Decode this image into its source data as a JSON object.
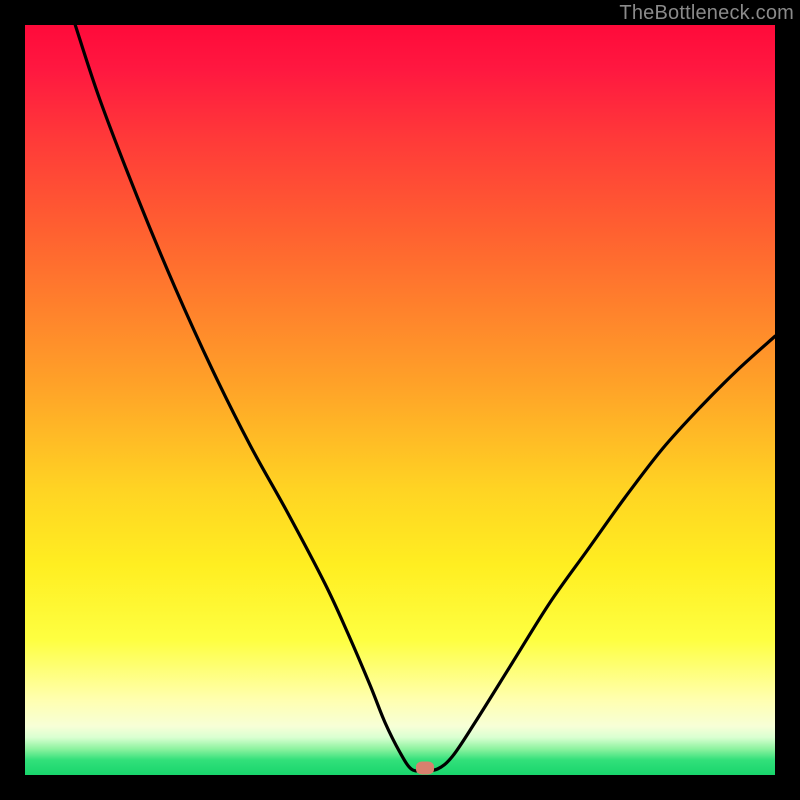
{
  "watermark": "TheBottleneck.com",
  "marker": {
    "x_pct": 53.3,
    "y_pct": 99.1
  },
  "chart_data": {
    "type": "line",
    "title": "",
    "xlabel": "",
    "ylabel": "",
    "xlim": [
      0,
      100
    ],
    "ylim": [
      0,
      100
    ],
    "series": [
      {
        "name": "bottleneck-curve",
        "x": [
          6.7,
          10,
          15,
          20,
          25,
          30,
          35,
          40,
          43,
          46,
          48,
          50,
          51.5,
          53,
          55,
          57,
          60,
          65,
          70,
          75,
          80,
          85,
          90,
          95,
          100
        ],
        "values": [
          100,
          90,
          77,
          65,
          54,
          44,
          35,
          25.5,
          19,
          12,
          7,
          3,
          0.8,
          0.6,
          0.8,
          2.5,
          7,
          15,
          23,
          30,
          37,
          43.5,
          49,
          54,
          58.5
        ]
      }
    ],
    "annotations": [
      {
        "type": "point",
        "name": "optimal-marker",
        "x": 53.3,
        "y": 0.9,
        "color": "#d9806e"
      }
    ],
    "background_gradient": {
      "direction": "vertical",
      "stops": [
        {
          "pos": 0.0,
          "color": "#ff0a3a"
        },
        {
          "pos": 0.15,
          "color": "#ff3939"
        },
        {
          "pos": 0.48,
          "color": "#ffa228"
        },
        {
          "pos": 0.72,
          "color": "#ffee21"
        },
        {
          "pos": 0.9,
          "color": "#ffffb0"
        },
        {
          "pos": 0.96,
          "color": "#8ef3a0"
        },
        {
          "pos": 1.0,
          "color": "#18d56c"
        }
      ]
    }
  }
}
